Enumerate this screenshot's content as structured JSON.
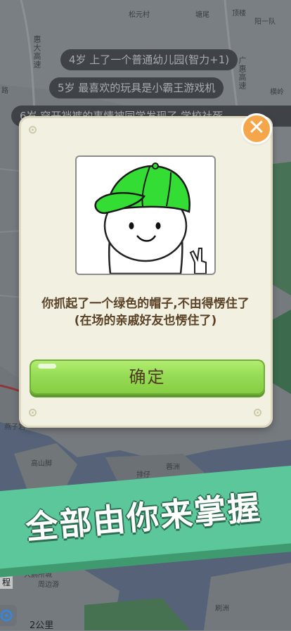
{
  "map": {
    "labels": {
      "songyuan": "松元村",
      "tangwei": "塘尾",
      "dingjing": "顶楼",
      "yangyidui": "阳一队",
      "huida": "惠大高速",
      "lu": "路",
      "guanghui": "广惠高速",
      "hengling": "横岭",
      "yanzi": "燕子岩",
      "gaoshan": "高山脚",
      "paizi": "排仔",
      "rongzhou": "蓉洲",
      "dapeng": "大鹏所城",
      "zhoubian": "周边游",
      "shazhou": "刷洲",
      "cheng": "程",
      "scale": "2公里"
    }
  },
  "log": {
    "line1": "4岁 上了一个普通幼儿园(智力+1)",
    "line2": "5岁 最喜欢的玩具是小霸王游戏机",
    "line3": "6岁 穿开裆裤的事情被同学发现了,学校社死"
  },
  "dialog": {
    "close_glyph": "✕",
    "message": "你抓起了一个绿色的帽子,不由得愣住了(在场的亲戚好友也愣住了)",
    "confirm_label": "确定"
  },
  "banner": {
    "slogan": "全部由你来掌握"
  },
  "colors": {
    "dialog_bg": "#f2f0e1",
    "confirm_green": "#97dc55",
    "close_orange": "#f6a64a",
    "banner_green": "#5cc79b",
    "hat_green": "#33dd33"
  },
  "icons": {
    "close": "close-icon",
    "locate": "locate-icon"
  }
}
